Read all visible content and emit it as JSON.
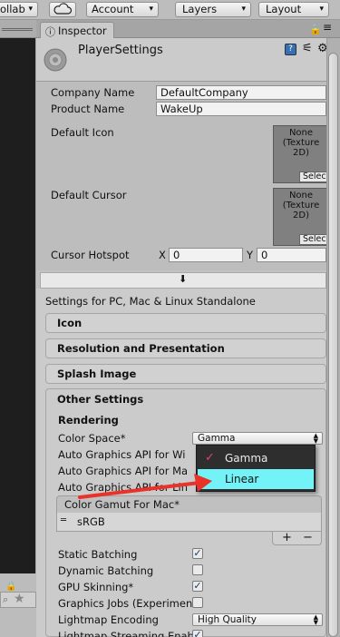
{
  "toolbar": {
    "collab_label": "ollab",
    "cloud_icon": "cloud-icon",
    "account_label": "Account",
    "layers_label": "Layers",
    "layout_label": "Layout"
  },
  "inspector": {
    "tab_label": "Inspector",
    "title": "PlayerSettings",
    "company_name_label": "Company Name",
    "company_name_value": "DefaultCompany",
    "product_name_label": "Product Name",
    "product_name_value": "WakeUp",
    "default_icon_label": "Default Icon",
    "default_cursor_label": "Default Cursor",
    "texture_none_text": "None\n(Texture\n2D)",
    "texture_select_label": "Select",
    "cursor_hotspot_label": "Cursor Hotspot",
    "hotspot_x_label": "X",
    "hotspot_x_value": "0",
    "hotspot_y_label": "Y",
    "hotspot_y_value": "0",
    "platform_label": "Settings for PC, Mac & Linux Standalone"
  },
  "sections": {
    "icon": "Icon",
    "resolution": "Resolution and Presentation",
    "splash": "Splash Image",
    "other": "Other Settings"
  },
  "other_settings": {
    "rendering_label": "Rendering",
    "color_space_label": "Color Space*",
    "color_space_value": "Gamma",
    "auto_graphics_win": "Auto Graphics API  for Wi",
    "auto_graphics_mac": "Auto Graphics API  for Ma",
    "auto_graphics_linux": "Auto Graphics API  for Lin",
    "color_gamut_header": "Color Gamut For Mac*",
    "color_gamut_item": "sRGB",
    "list_add": "+",
    "list_remove": "−",
    "static_batching_label": "Static Batching",
    "static_batching": true,
    "dynamic_batching_label": "Dynamic Batching",
    "dynamic_batching": false,
    "gpu_skinning_label": "GPU Skinning*",
    "gpu_skinning": true,
    "graphics_jobs_label": "Graphics Jobs (Experimen",
    "graphics_jobs": false,
    "lightmap_encoding_label": "Lightmap Encoding",
    "lightmap_encoding_value": "High Quality",
    "lightmap_streaming_label": "Lightmap Streaming Enab",
    "lightmap_streaming": true
  },
  "popup": {
    "options": [
      "Gamma",
      "Linear"
    ],
    "selected": "Gamma",
    "highlighted": "Linear"
  },
  "colors": {
    "highlight": "#73f2f7",
    "annotation_arrow": "#e8322a",
    "check_tick": "#e0446a"
  }
}
